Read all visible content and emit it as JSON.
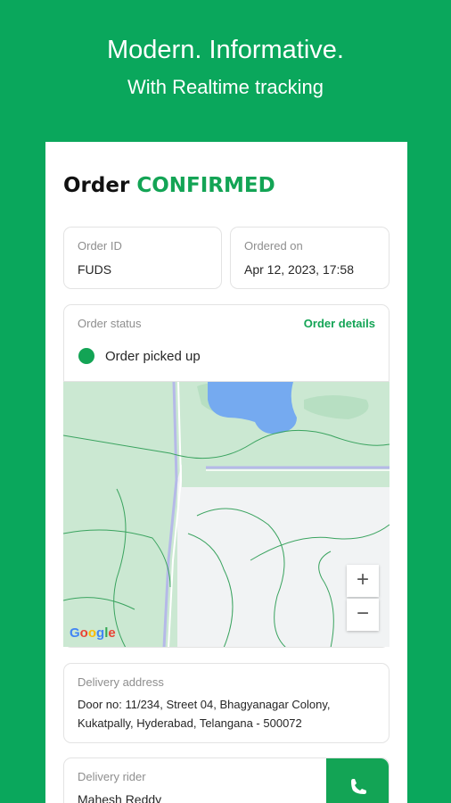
{
  "promo": {
    "title": "Modern. Informative.",
    "subtitle": "With Realtime tracking"
  },
  "header": {
    "title_prefix": "Order",
    "title_status": "CONFIRMED"
  },
  "order": {
    "id_label": "Order ID",
    "id_value": "FUDS",
    "ordered_label": "Ordered on",
    "ordered_value": "Apr 12, 2023, 17:58"
  },
  "status": {
    "label": "Order status",
    "details_link": "Order details",
    "current": "Order picked up"
  },
  "map": {
    "zoom_in": "+",
    "zoom_out": "−",
    "attribution": "Google"
  },
  "delivery": {
    "address_label": "Delivery address",
    "address_line1": "Door no: 11/234, Street 04, Bhagyanagar Colony,",
    "address_line2": "Kukatpally, Hyderabad, Telangana - 500072"
  },
  "rider": {
    "label": "Delivery rider",
    "name": "Mahesh Reddy"
  },
  "colors": {
    "brand_green": "#0aa75c",
    "accent_green": "#13a455",
    "map_green": "#cbe8d2",
    "map_water": "#75aaf0"
  }
}
